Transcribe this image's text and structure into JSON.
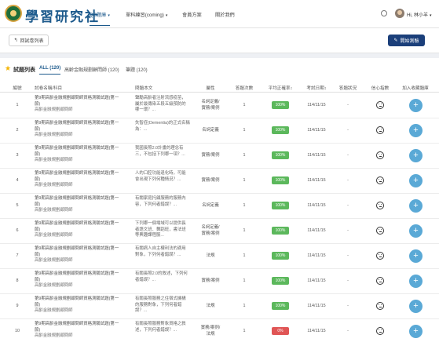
{
  "brand": {
    "title": "學習研究社",
    "logo": "academy-seal-logo"
  },
  "nav": {
    "items": [
      {
        "label": "QB題庫",
        "dropdown": true,
        "active": true
      },
      {
        "label": "單科練習(coming)",
        "dropdown": true,
        "active": false
      },
      {
        "label": "會員方案",
        "dropdown": false,
        "active": false
      },
      {
        "label": "關於我們",
        "dropdown": false,
        "active": false
      }
    ],
    "search_icon": "search-icon",
    "user": {
      "name": "Hi, 林小羊",
      "caret": "▾"
    }
  },
  "toolbar": {
    "back": {
      "icon": "↰",
      "label": "回試卷列表"
    },
    "start": {
      "icon": "✎",
      "label": "開始測驗"
    }
  },
  "list": {
    "title": "試題列表",
    "tabs": [
      {
        "label": "ALL (120)",
        "active": true
      },
      {
        "label": "高齡金融規劃顧問師 (120)",
        "active": false
      },
      {
        "label": "筆題 (120)",
        "active": false
      }
    ]
  },
  "table": {
    "headers": [
      "編號",
      "試卷名稱/科目",
      "問題本文",
      "屬性",
      "答題次數",
      "平均正確率",
      "考試日期",
      "答題狀況",
      "信心指數",
      "加入收藏題庫"
    ],
    "sort_icons": {
      "avg": "↕",
      "date": "↕"
    },
    "rows": [
      {
        "no": "1",
        "exam": "第9期高齡金融規劃顧問師資格測驗試題(第一節)",
        "subject": "高齡金融規劃顧問師",
        "question": "聲勵高齡者注射流感疫苗，屬於最傳染五段五級預防的哪一環？...",
        "attr": [
          "名詞定義/",
          "實務/案例"
        ],
        "count": "1",
        "rate": "100%",
        "rate_color": "#5cb85c",
        "date": "114/11/15",
        "status": "-"
      },
      {
        "no": "2",
        "exam": "第9期高齡金融規劃顧問師資格測驗試題(第一節)",
        "subject": "高齡金融規劃顧問師",
        "question": "失智症(Dementia)的正式名稱為：...",
        "attr": [
          "名詞定義"
        ],
        "count": "1",
        "rate": "100%",
        "rate_color": "#5cb85c",
        "date": "114/11/15",
        "status": "-"
      },
      {
        "no": "3",
        "exam": "第9期高齡金融規劃顧問師資格測驗試題(第一節)",
        "subject": "高齡金融規劃顧問師",
        "question": "我國長照2.0計畫的理念有三，不包括下列哪一項？...",
        "attr": [
          "實務/案例"
        ],
        "count": "1",
        "rate": "100%",
        "rate_color": "#5cb85c",
        "date": "114/11/15",
        "status": "-"
      },
      {
        "no": "4",
        "exam": "第9期高齡金融規劃顧問師資格測驗試題(第一節)",
        "subject": "高齡金融規劃顧問師",
        "question": "人的口腔功能退化時，可能會出現下列何種情況？...",
        "attr": [
          "實務/案例"
        ],
        "count": "1",
        "rate": "100%",
        "rate_color": "#5cb85c",
        "date": "114/11/15",
        "status": "-"
      },
      {
        "no": "5",
        "exam": "第9期高齡金融規劃顧問師資格測驗試題(第一節)",
        "subject": "高齡金融規劃顧問師",
        "question": "有關家庭托顧服務的服務內容，下列何者錯誤？...",
        "attr": [
          "名詞定義"
        ],
        "count": "1",
        "rate": "100%",
        "rate_color": "#5cb85c",
        "date": "114/11/15",
        "status": "-"
      },
      {
        "no": "6",
        "exam": "第9期高齡金融規劃顧問師資格測驗試題(第一節)",
        "subject": "高齡金融規劃顧問師",
        "question": "下列哪一個場域可以提供長者語文班、舞蹈班，書法班等興趣課程服...",
        "attr": [
          "名詞定義/",
          "實務/案例"
        ],
        "count": "1",
        "rate": "100%",
        "rate_color": "#5cb85c",
        "date": "114/11/15",
        "status": "-"
      },
      {
        "no": "7",
        "exam": "第9期高齡金融規劃顧問師資格測驗試題(第一節)",
        "subject": "高齡金融規劃顧問師",
        "question": "有關病人自主權利法的適用對象，下列何者錯誤？...",
        "attr": [
          "法規"
        ],
        "count": "1",
        "rate": "100%",
        "rate_color": "#5cb85c",
        "date": "114/11/15",
        "status": "-"
      },
      {
        "no": "8",
        "exam": "第9期高齡金融規劃顧問師資格測驗試題(第一節)",
        "subject": "高齡金融規劃顧問師",
        "question": "有關長照2.0的敘述，下列何者錯誤？...",
        "attr": [
          "實務/案例"
        ],
        "count": "1",
        "rate": "100%",
        "rate_color": "#5cb85c",
        "date": "114/11/15",
        "status": "-"
      },
      {
        "no": "9",
        "exam": "第9期高齡金融規劃顧問師資格測驗試題(第一節)",
        "subject": "高齡金融規劃顧問師",
        "question": "有關長照服務之住宿式機構的服務對象，下列何者錯誤？...",
        "attr": [
          "法規"
        ],
        "count": "1",
        "rate": "100%",
        "rate_color": "#5cb85c",
        "date": "114/11/15",
        "status": "-"
      },
      {
        "no": "10",
        "exam": "第9期高齡金融規劃顧問師資格測驗試題(第一節)",
        "subject": "高齡金融規劃顧問師",
        "question": "有關長照服務對象資格之敘述，下列何者錯誤？...",
        "attr": [
          "實務/案例/",
          "法規"
        ],
        "count": "1",
        "rate": "0%",
        "rate_color": "#e05555",
        "date": "114/11/15",
        "status": "-"
      }
    ],
    "confidence_icon": "neutral-face-icon",
    "add_icon": "+"
  }
}
